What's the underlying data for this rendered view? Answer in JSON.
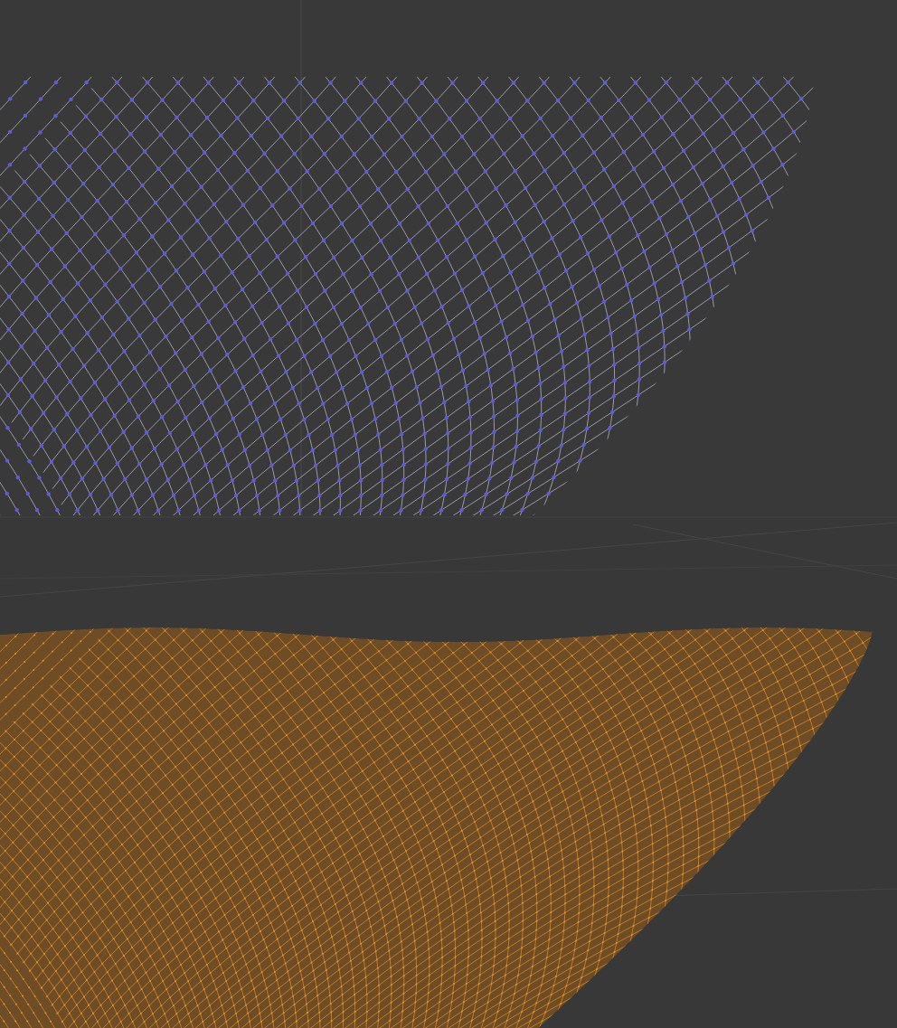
{
  "viewports": [
    {
      "kind": "vertex-mesh",
      "color": "#5b5ce0"
    },
    {
      "kind": "face-mesh",
      "color": "#e8912a"
    }
  ]
}
